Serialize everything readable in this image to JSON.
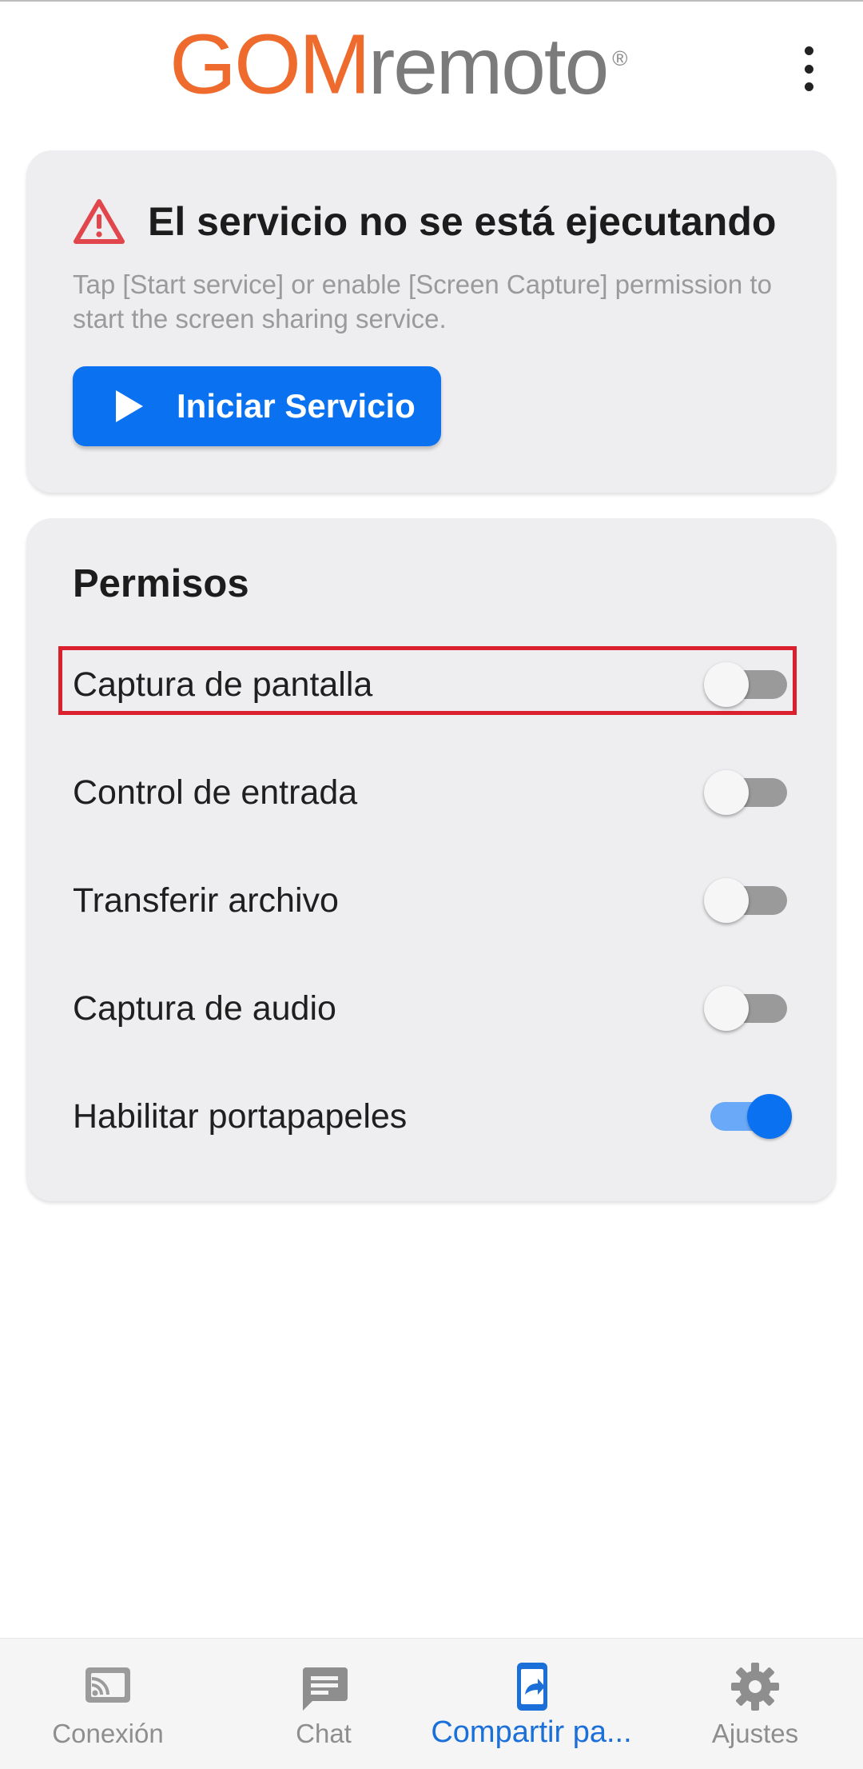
{
  "header": {
    "logo_brand": "GOM",
    "logo_word": "remoto",
    "logo_reg": "®",
    "menu_icon": "more-vert-icon"
  },
  "status_card": {
    "icon": "warning-triangle-icon",
    "title": "El servicio no se está ejecutando",
    "description": "Tap [Start service] or enable [Screen Capture] permission to start the screen sharing service.",
    "button_icon": "play-icon",
    "button_label": "Iniciar Servicio"
  },
  "permissions": {
    "title": "Permisos",
    "items": [
      {
        "label": "Captura de pantalla",
        "enabled": false,
        "highlighted": true
      },
      {
        "label": "Control de entrada",
        "enabled": false
      },
      {
        "label": "Transferir archivo",
        "enabled": false
      },
      {
        "label": "Captura de audio",
        "enabled": false
      },
      {
        "label": "Habilitar portapapeles",
        "enabled": true
      }
    ]
  },
  "bottom_nav": {
    "items": [
      {
        "label": "Conexión",
        "icon": "cast-icon",
        "active": false
      },
      {
        "label": "Chat",
        "icon": "chat-icon",
        "active": false
      },
      {
        "label": "Compartir pa...",
        "icon": "screen-share-icon",
        "active": true
      },
      {
        "label": "Ajustes",
        "icon": "settings-gear-icon",
        "active": false
      }
    ]
  },
  "colors": {
    "brand_orange": "#ee6a2d",
    "accent_blue": "#0a72f0",
    "highlight_red": "#dc1f2c",
    "warning_red": "#e0464b"
  }
}
